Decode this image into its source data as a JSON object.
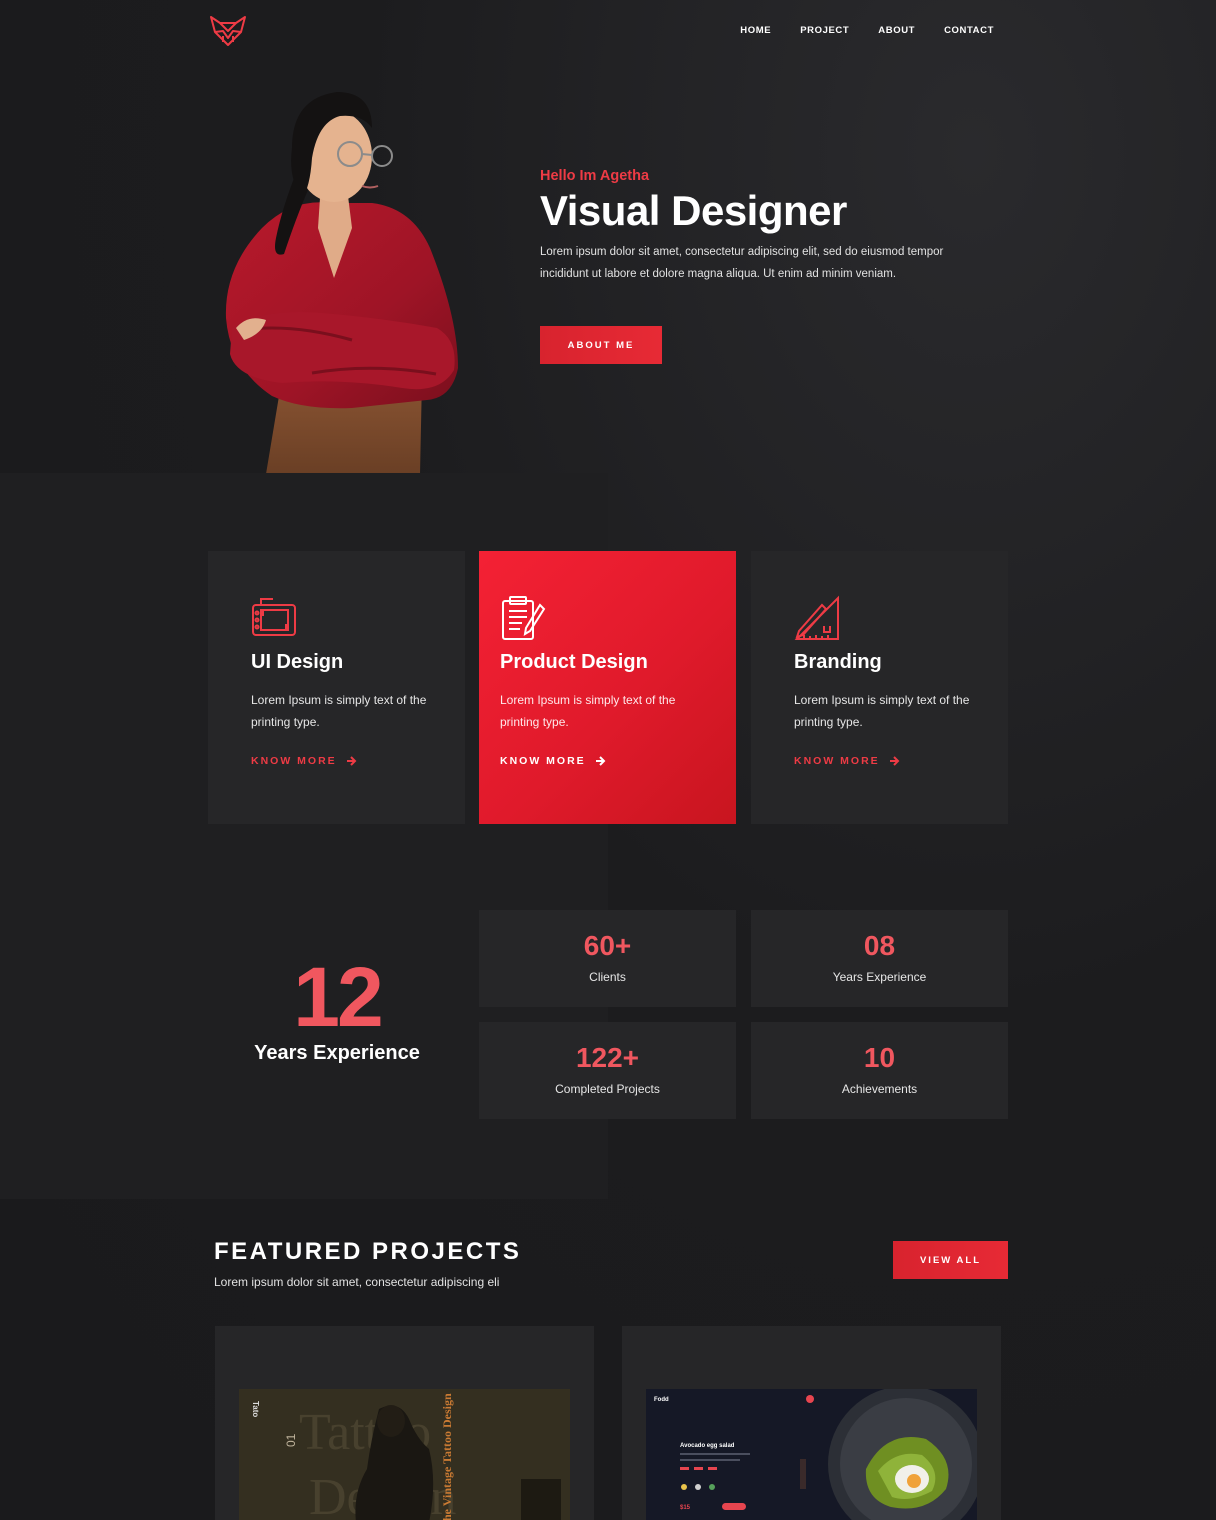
{
  "nav": {
    "items": [
      "HOME",
      "PROJECT",
      "ABOUT",
      "CONTACT"
    ]
  },
  "hero": {
    "greeting": "Hello Im Agetha",
    "title": "Visual Designer",
    "description": "Lorem ipsum dolor sit amet, consectetur adipiscing elit, sed do eiusmod tempor incididunt ut labore et dolore magna aliqua. Ut enim ad minim veniam.",
    "cta_label": "ABOUT ME"
  },
  "services": [
    {
      "title": "UI Design",
      "text": "Lorem Ipsum is simply text of the printing type.",
      "link": "KNOW MORE",
      "icon": "tablet-icon"
    },
    {
      "title": "Product Design",
      "text": "Lorem Ipsum is simply text of the printing type.",
      "link": "KNOW MORE",
      "icon": "clipboard-icon"
    },
    {
      "title": "Branding",
      "text": "Lorem Ipsum is simply text of the printing type.",
      "link": "KNOW MORE",
      "icon": "ruler-pencil-icon"
    }
  ],
  "experience": {
    "number": "12",
    "label": "Years Experience"
  },
  "stats": [
    {
      "num": "60+",
      "label": "Clients"
    },
    {
      "num": "08",
      "label": "Years Experience"
    },
    {
      "num": "122+",
      "label": "Completed Projects"
    },
    {
      "num": "10",
      "label": "Achievements"
    }
  ],
  "featured": {
    "title": "FEATURED PROJECTS",
    "subtitle": "Lorem ipsum dolor sit amet, consectetur adipiscing eli",
    "view_all": "VIEW ALL",
    "projects": [
      {
        "name": "tattoo-project",
        "side_title": "The Vintage Tattoo Design",
        "brand": "Tato",
        "bg_word": "Tattoo Design",
        "number": "01"
      },
      {
        "name": "food-project",
        "brand": "Fodd",
        "dish": "Avocado egg salad",
        "price": "$15"
      }
    ]
  },
  "colors": {
    "accent": "#e72a35",
    "accent_light": "#f0575f",
    "bg": "#1b1b1d",
    "card": "#262628"
  }
}
